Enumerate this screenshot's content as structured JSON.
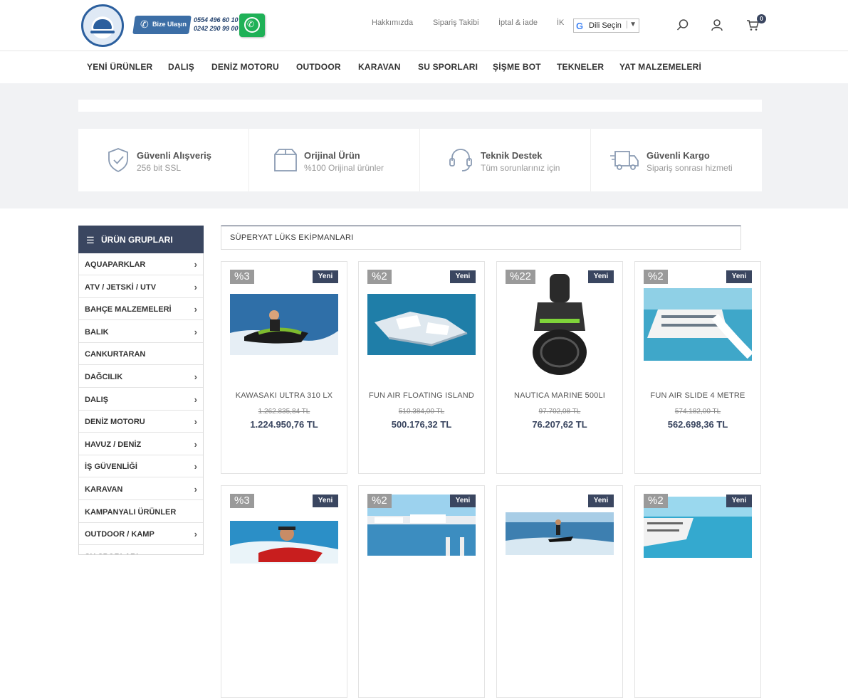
{
  "header": {
    "logo_text": "DENIZMARKETIMIZ",
    "contact_label": "Bize Ulaşın",
    "phones": [
      "0554 496 60 10",
      "0242 290 99 00"
    ],
    "links": [
      "Hakkımızda",
      "Sipariş Takibi",
      "İptal & iade",
      "İK"
    ],
    "language_select": "Dili Seçin",
    "cart_count": "0"
  },
  "nav": [
    "YENİ ÜRÜNLER",
    "DALIŞ",
    "DENİZ MOTORU",
    "OUTDOOR",
    "KARAVAN",
    "SU SPORLARI",
    "ŞİŞME BOT",
    "TEKNELER",
    "YAT MALZEMELERİ"
  ],
  "features": [
    {
      "title": "Güvenli Alışveriş",
      "sub": "256 bit SSL",
      "icon": "shield-check-icon"
    },
    {
      "title": "Orijinal Ürün",
      "sub": "%100 Orijinal ürünler",
      "icon": "box-icon"
    },
    {
      "title": "Teknik Destek",
      "sub": "Tüm sorunlarınız için",
      "icon": "headset-icon"
    },
    {
      "title": "Güvenli Kargo",
      "sub": "Sipariş sonrası hizmeti",
      "icon": "truck-icon"
    }
  ],
  "sidebar": {
    "title": "ÜRÜN GRUPLARI",
    "items": [
      {
        "label": "AQUAPARKLAR",
        "chevron": true
      },
      {
        "label": "ATV / JETSKİ / UTV",
        "chevron": true
      },
      {
        "label": "BAHÇE MALZEMELERİ",
        "chevron": true
      },
      {
        "label": "BALIK",
        "chevron": true
      },
      {
        "label": "CANKURTARAN",
        "chevron": false
      },
      {
        "label": "DAĞCILIK",
        "chevron": true
      },
      {
        "label": "DALIŞ",
        "chevron": true
      },
      {
        "label": "DENİZ MOTORU",
        "chevron": true
      },
      {
        "label": "HAVUZ / DENİZ",
        "chevron": true
      },
      {
        "label": "İŞ GÜVENLİĞİ",
        "chevron": true
      },
      {
        "label": "KARAVAN",
        "chevron": true
      },
      {
        "label": "KAMPANYALI ÜRÜNLER",
        "chevron": false
      },
      {
        "label": "OUTDOOR / KAMP",
        "chevron": true
      },
      {
        "label": "SU SPORLARI",
        "chevron": true
      }
    ]
  },
  "section_title": "SÜPERYAT LÜKS EKİPMANLARI",
  "badge_new": "Yeni",
  "products": [
    {
      "discount": "%3",
      "name": "KAWASAKI ULTRA 310 LX",
      "old_price": "1.262.835,84 TL",
      "price": "1.224.950,76 TL",
      "image": "jetski"
    },
    {
      "discount": "%2",
      "name": "FUN AIR FLOATING ISLAND",
      "old_price": "510.384,00 TL",
      "price": "500.176,32 TL",
      "image": "island"
    },
    {
      "discount": "%22",
      "name": "NAUTICA MARINE 500LI",
      "old_price": "97.702,08 TL",
      "price": "76.207,62 TL",
      "image": "scooter"
    },
    {
      "discount": "%2",
      "name": "FUN AIR SLIDE 4 METRE",
      "old_price": "574.182,00 TL",
      "price": "562.698,36 TL",
      "image": "yacht-slide"
    },
    {
      "discount": "%3",
      "name": "",
      "old_price": "",
      "price": "",
      "image": "jetski-rider"
    },
    {
      "discount": "%2",
      "name": "",
      "old_price": "",
      "price": "",
      "image": "marina"
    },
    {
      "discount": "",
      "name": "",
      "old_price": "",
      "price": "",
      "image": "jetboard"
    },
    {
      "discount": "%2",
      "name": "",
      "old_price": "",
      "price": "",
      "image": "yacht-deck"
    }
  ]
}
